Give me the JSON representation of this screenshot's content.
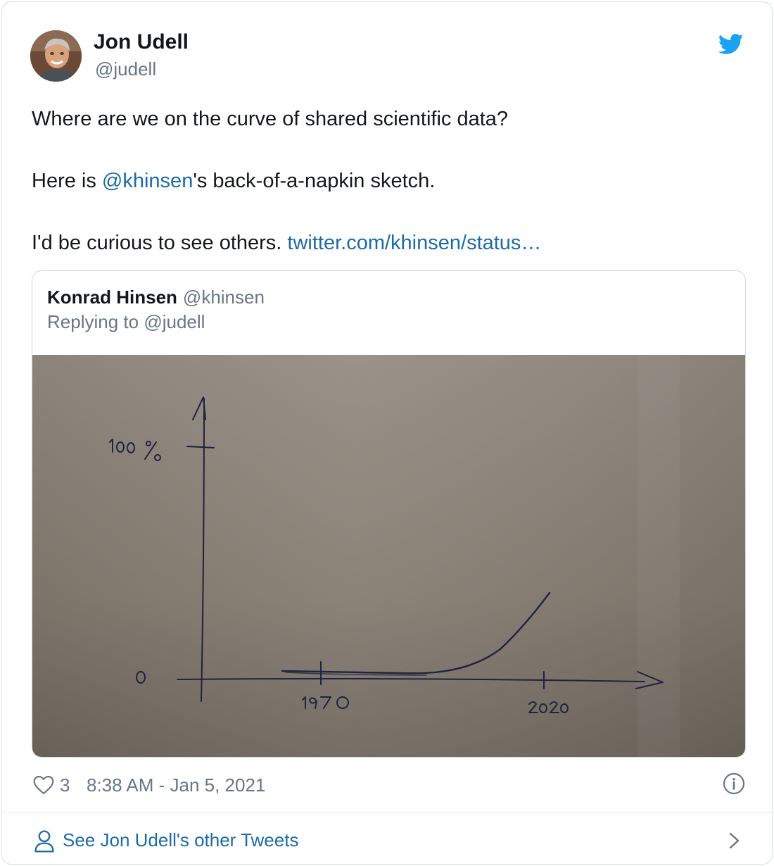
{
  "author": {
    "name": "Jon Udell",
    "handle": "@judell"
  },
  "tweet": {
    "line1": "Where are we on the curve of shared scientific data?",
    "line2_before": "Here is ",
    "line2_mention": "@khinsen",
    "line2_after": "'s back-of-a-napkin sketch.",
    "line3_before": "I'd be curious to see others. ",
    "line3_link": "twitter.com/khinsen/status…"
  },
  "quoted_tweet": {
    "name": "Konrad Hinsen",
    "handle": "@khinsen",
    "replying_prefix": "Replying to ",
    "replying_to": "@judell",
    "image": {
      "y_top_label": "100 %",
      "y_zero_label": "0",
      "x_label_1": "1970",
      "x_label_2": "2020"
    }
  },
  "footer": {
    "likes": "3",
    "timestamp": "8:38 AM - Jan 5, 2021"
  },
  "see_more": {
    "label": "See Jon Udell's other Tweets"
  },
  "colors": {
    "link": "#1b6ba6",
    "secondary_text": "#657786",
    "twitter_blue": "#1da1f2",
    "napkin": "#8c8479"
  },
  "icons": [
    "twitter-bird-icon",
    "heart-icon",
    "info-icon",
    "person-icon",
    "chevron-right-icon"
  ]
}
